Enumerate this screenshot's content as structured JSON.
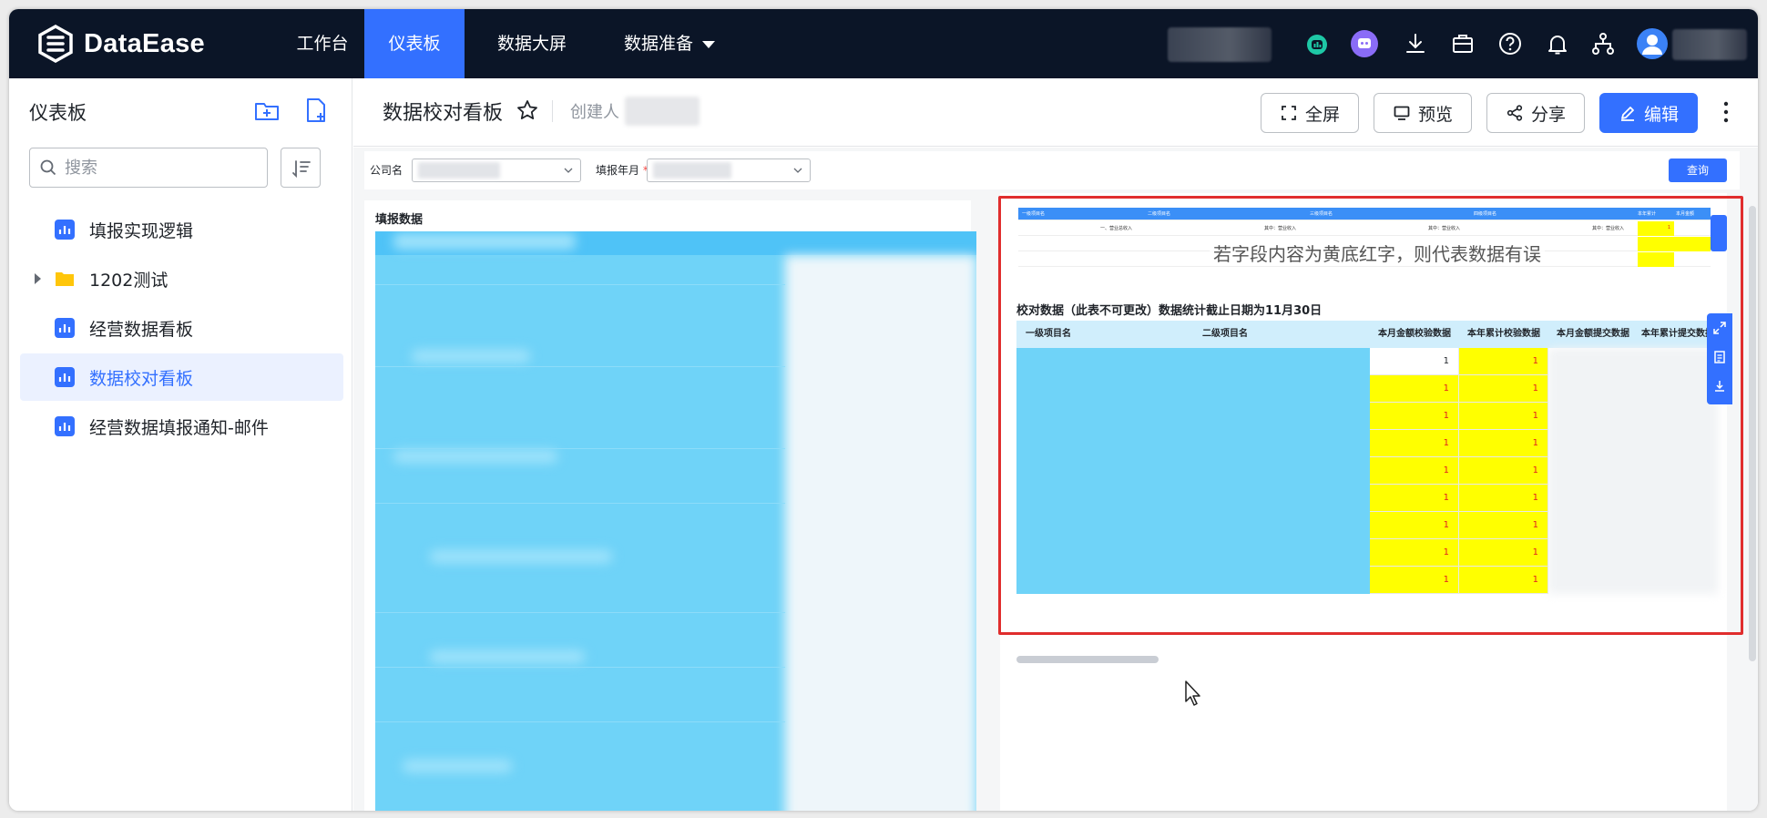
{
  "app": {
    "name": "DataEase"
  },
  "nav": {
    "items": [
      {
        "label": "工作台"
      },
      {
        "label": "仪表板"
      },
      {
        "label": "数据大屏"
      },
      {
        "label": "数据准备"
      }
    ],
    "active_index": 1
  },
  "sidebar": {
    "title": "仪表板",
    "search_placeholder": "搜索",
    "items": [
      {
        "label": "填报实现逻辑",
        "icon": "chart-icon"
      },
      {
        "label": "1202测试",
        "icon": "folder-icon"
      },
      {
        "label": "经营数据看板",
        "icon": "chart-icon"
      },
      {
        "label": "数据校对看板",
        "icon": "chart-icon"
      },
      {
        "label": "经营数据填报通知-邮件",
        "icon": "chart-icon"
      }
    ],
    "active_index": 3
  },
  "header": {
    "title": "数据校对看板",
    "creator_label": "创建人",
    "buttons": {
      "fullscreen": "全屏",
      "preview": "预览",
      "share": "分享",
      "edit": "编辑"
    }
  },
  "filters": {
    "company_label": "公司名",
    "period_label": "填报年月",
    "required_mark": "*",
    "query_label": "查询"
  },
  "left_panel": {
    "title": "填报数据"
  },
  "right_panel": {
    "note": "若字段内容为黄底红字，则代表数据有误",
    "table_title": "校对数据（此表不可更改）数据统计截止日期为11月30日",
    "columns": [
      "一级项目名",
      "二级项目名",
      "本月金额校验数据",
      "本年累计校验数据",
      "本月金额提交数据",
      "本年累计提交数据"
    ],
    "check_rows": [
      {
        "month": "1",
        "year": "1",
        "month_error": false
      },
      {
        "month": "1",
        "year": "1",
        "month_error": true
      },
      {
        "month": "1",
        "year": "1",
        "month_error": true
      },
      {
        "month": "1",
        "year": "1",
        "month_error": true
      },
      {
        "month": "1",
        "year": "1",
        "month_error": true
      },
      {
        "month": "1",
        "year": "1",
        "month_error": true
      },
      {
        "month": "1",
        "year": "1",
        "month_error": true
      },
      {
        "month": "1",
        "year": "1",
        "month_error": true
      },
      {
        "month": "1",
        "year": "1",
        "month_error": true
      }
    ],
    "mini_table": {
      "headers": [
        "一级项目名",
        "二级项目名",
        "三级项目名",
        "四级项目名",
        "本年累计",
        "本月金额"
      ],
      "rows": [
        [
          "一、营业总收入",
          "其中：营业收入",
          "其中：营业收入",
          "其中：营业收入",
          "1",
          ""
        ],
        [
          "",
          "",
          "",
          "",
          "",
          ""
        ],
        [
          "",
          "",
          "",
          "",
          "",
          ""
        ]
      ]
    }
  },
  "colors": {
    "nav_bg": "#0b1527",
    "accent": "#3370ff",
    "error_bg": "#ffff00",
    "error_text": "#e02020",
    "highlight_border": "#e02d2d"
  }
}
